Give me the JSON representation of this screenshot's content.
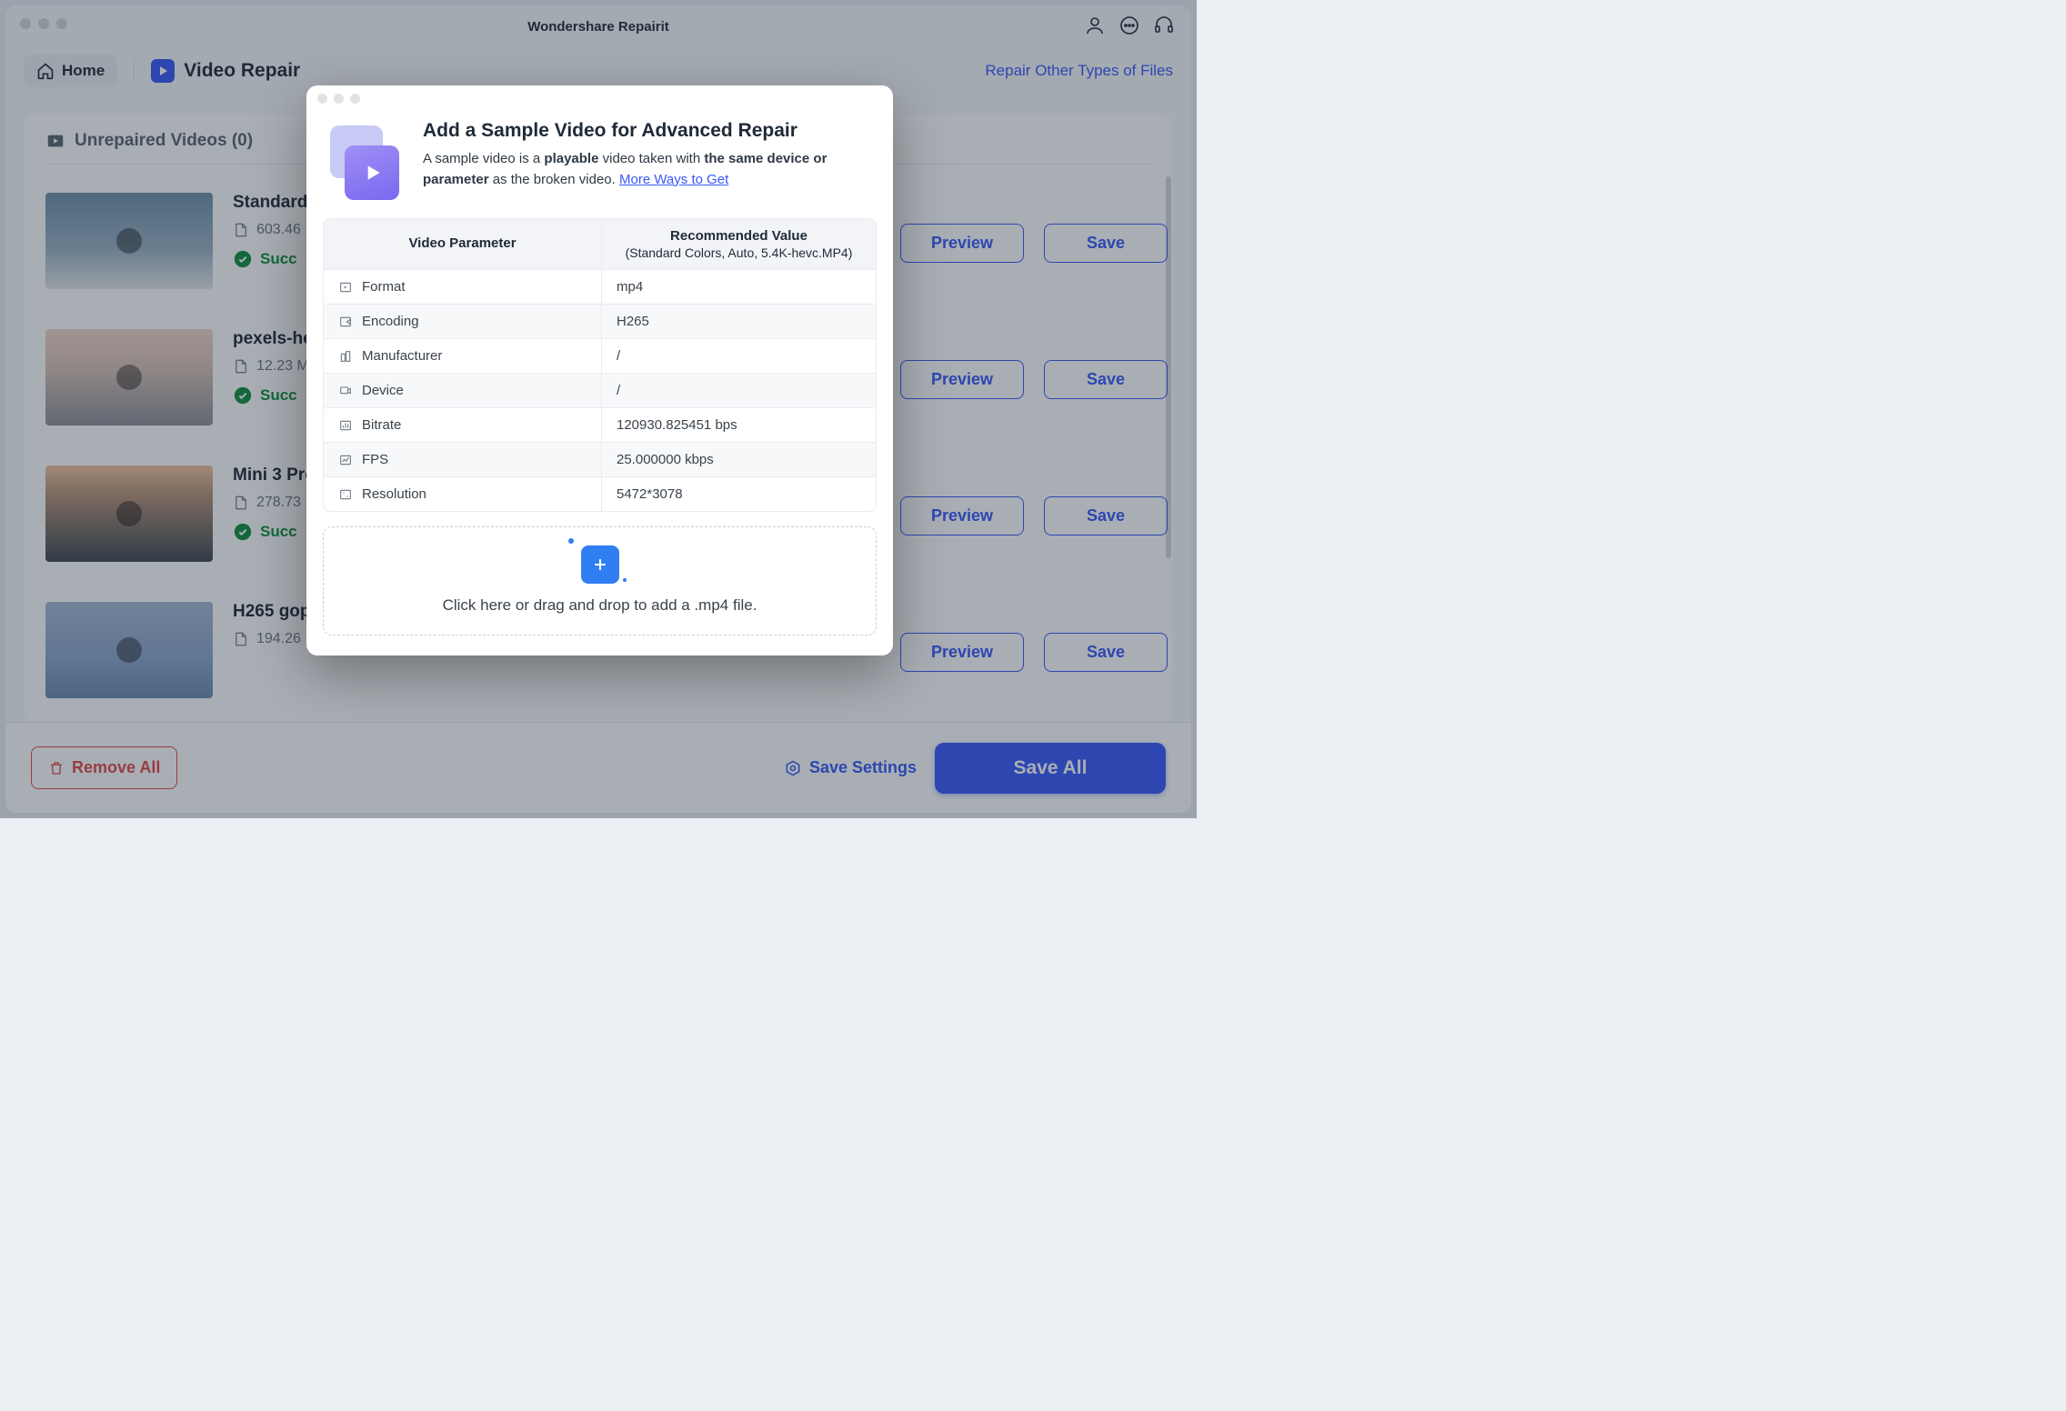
{
  "titlebar": {
    "app_title": "Wondershare Repairit"
  },
  "toolbar": {
    "home_label": "Home",
    "section_label": "Video Repair",
    "repair_other_link": "Repair Other Types of Files"
  },
  "list": {
    "header": "Unrepaired Videos (0)",
    "items": [
      {
        "name": "Standard",
        "size": "603.46",
        "status": "Succ"
      },
      {
        "name": "pexels-he",
        "size": "12.23 M",
        "status": "Succ"
      },
      {
        "name": "Mini 3 Pro",
        "size": "278.73",
        "status": "Succ"
      },
      {
        "name": "H265 gop",
        "size": "194.26",
        "status": ""
      }
    ],
    "preview_label": "Preview",
    "save_label": "Save"
  },
  "footer": {
    "remove_all": "Remove All",
    "save_settings": "Save Settings",
    "save_all": "Save All"
  },
  "modal": {
    "title": "Add a Sample Video for Advanced Repair",
    "desc_1": "A sample video is a ",
    "desc_b1": "playable",
    "desc_2": " video taken with ",
    "desc_b2": "the same device or parameter",
    "desc_3": " as the broken video. ",
    "desc_link": "More Ways to Get",
    "table": {
      "header_left": "Video Parameter",
      "header_right_line1": "Recommended Value",
      "header_right_line2": "(Standard Colors, Auto, 5.4K-hevc.MP4)",
      "rows": [
        {
          "label": "Format",
          "value": "mp4"
        },
        {
          "label": "Encoding",
          "value": "H265"
        },
        {
          "label": "Manufacturer",
          "value": "/"
        },
        {
          "label": "Device",
          "value": "/"
        },
        {
          "label": "Bitrate",
          "value": "120930.825451 bps"
        },
        {
          "label": "FPS",
          "value": "25.000000 kbps"
        },
        {
          "label": "Resolution",
          "value": "5472*3078"
        }
      ]
    },
    "dropzone_text": "Click here or drag and drop to add a .mp4 file."
  }
}
